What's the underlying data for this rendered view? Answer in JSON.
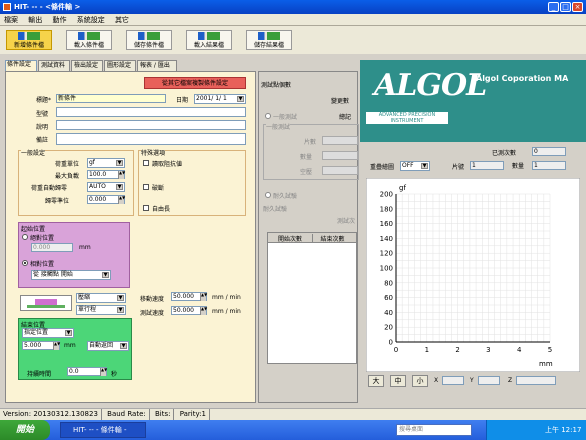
{
  "window": {
    "title": "HIT- -- - <條件輸 >"
  },
  "menu": [
    "檔案",
    "輸出",
    "動作",
    "系統設定",
    "其它"
  ],
  "toolbar": [
    "新增條件檔",
    "載入條件檔",
    "儲存條件檔",
    "載入結果檔",
    "儲存結果檔"
  ],
  "tabs": [
    "條件設定",
    "測試資料",
    "檢出設定",
    "圖形設定",
    "報表 / 匯出"
  ],
  "form": {
    "copy_button": "從其它檔案複製條件設定",
    "title_label": "標題*",
    "title_value": "新條件",
    "date_label": "日期",
    "date_value": "2001/ 1/ 1",
    "model_label": "型號",
    "desc_label": "說明",
    "note_label": "備註"
  },
  "general": {
    "title": "一般設定",
    "load_unit_label": "荷重單位",
    "load_unit_value": "gf",
    "max_load_label": "最大負載",
    "max_load_value": "100.0",
    "auto_return_label": "荷重自動歸零",
    "auto_return_value": "AUTO",
    "zero_label": "歸零準位",
    "zero_value": "0.000"
  },
  "special": {
    "title": "特殊選項",
    "opt1": "讀取阻抗値",
    "opt2": "破斷",
    "opt3": "自由長"
  },
  "start_pos": {
    "title": "起始位置",
    "absolute": "絕對位置",
    "abs_value": "0.000",
    "abs_unit": "mm",
    "relative": "相對位置",
    "rel_value": "從 接觸點 開始"
  },
  "motion": {
    "mode1": "壓縮",
    "mode2": "單行程",
    "move_speed_label": "移動速度",
    "move_speed_value": "50.000",
    "test_speed_label": "測試速度",
    "test_speed_value": "50.000",
    "speed_unit": "mm / min"
  },
  "end_pos": {
    "title": "結束位置",
    "mode": "指定位置",
    "value": "5.000",
    "unit": "mm",
    "return": "自動返回",
    "hold_label": "持續時間",
    "hold_value": "0.0",
    "hold_unit": "秒"
  },
  "mid": {
    "title": "測試點個數",
    "change_label": "變更數",
    "general_test": "一般測試",
    "total_label": "總記",
    "general_group": "一般測試",
    "pieces_label": "片數",
    "count_label": "數量",
    "empty_label": "空壓",
    "endurance": "耐久試驗",
    "endurance_group": "耐久試驗",
    "test_times": "測試次",
    "col1": "開始次數",
    "col2": "結束次數"
  },
  "logo": {
    "brand": "ALGOL",
    "sub": "ADVANCED PRECISION INSTRUMENT",
    "company": "Algol Coporation  MA"
  },
  "graph_panel": {
    "done_label": "已測次數",
    "done_value": "0",
    "sweep_label": "重疊繪圖",
    "sweep_value": "OFF",
    "piece_label": "片號",
    "piece_value": "1",
    "count_label": "數量",
    "count_value": "1",
    "y_unit": "gf",
    "x_unit": "mm",
    "zoom_big": "大",
    "zoom_mid": "中",
    "zoom_small": "小",
    "x_label": "X",
    "y_label": "Y",
    "z_label": "Z"
  },
  "chart_data": {
    "type": "line",
    "title": "",
    "xlabel": "mm",
    "ylabel": "gf",
    "xlim": [
      0,
      5
    ],
    "ylim": [
      0,
      200
    ],
    "x_ticks": [
      "0",
      "1",
      "2",
      "3",
      "4",
      "5"
    ],
    "y_ticks": [
      "0",
      "20",
      "40",
      "60",
      "80",
      "100",
      "120",
      "140",
      "160",
      "180",
      "200"
    ],
    "series": [],
    "grid": true
  },
  "status": {
    "version": "Version: 20130312.130823",
    "baud": "Baud Rate:",
    "bits": "Bits:",
    "parity": "Parity:1"
  },
  "taskbar": {
    "start": "開始",
    "task": "HIT- -- - 條件輸 -",
    "search": "搜尋桌面",
    "clock": "上午 12:17"
  }
}
